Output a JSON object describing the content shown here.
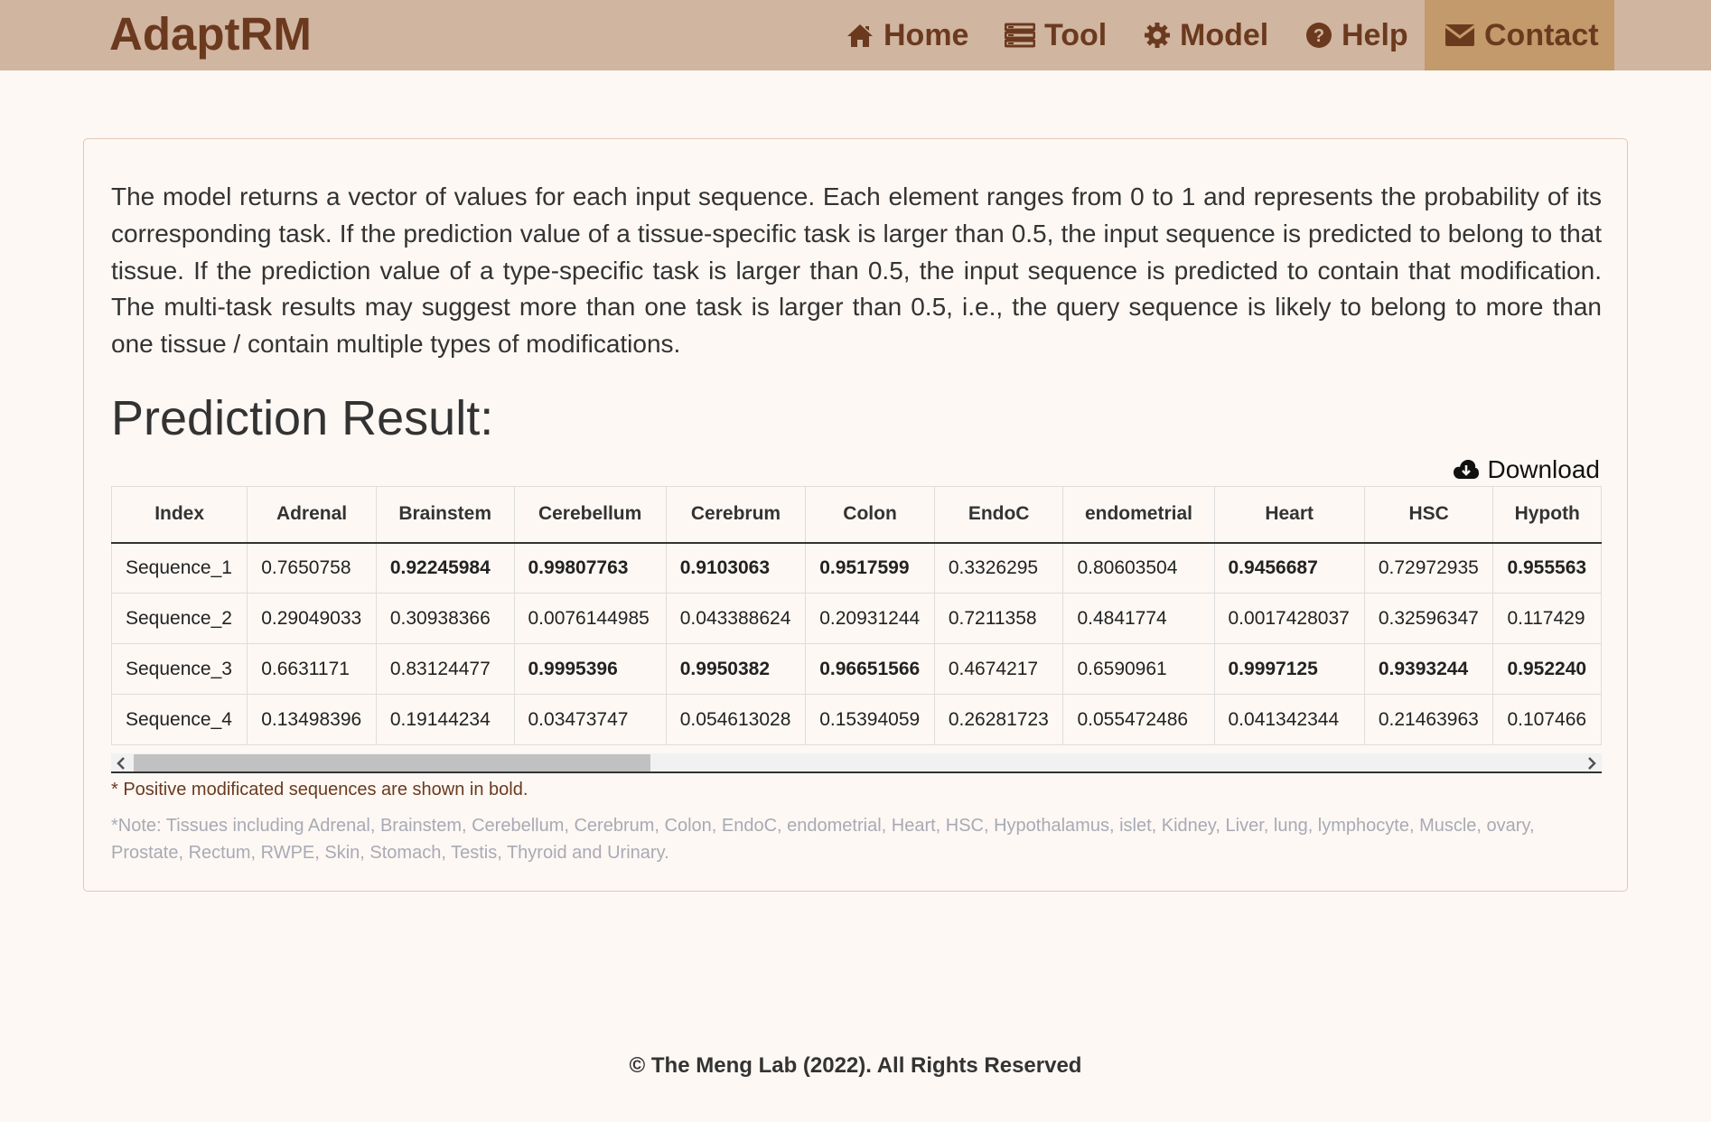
{
  "navbar": {
    "brand": "AdaptRM",
    "items": [
      {
        "label": "Home",
        "icon": "home-icon"
      },
      {
        "label": "Tool",
        "icon": "tool-icon"
      },
      {
        "label": "Model",
        "icon": "gear-icon"
      },
      {
        "label": "Help",
        "icon": "question-icon"
      },
      {
        "label": "Contact",
        "icon": "envelope-icon"
      }
    ],
    "active": "Contact"
  },
  "intro": "The model returns a vector of values for each input sequence. Each element ranges from 0 to 1 and represents the probability of its corresponding task. If the prediction value of a tissue-specific task is larger than 0.5, the input sequence is predicted to belong to that tissue. If the prediction value of a type-specific task is larger than 0.5, the input sequence is predicted to contain that modification. The multi-task results may suggest more than one task is larger than 0.5, i.e., the query sequence is likely to belong to more than one tissue / contain multiple types of modifications.",
  "result_title": "Prediction Result:",
  "download_label": "Download",
  "table": {
    "columns": [
      "Index",
      "Adrenal",
      "Brainstem",
      "Cerebellum",
      "Cerebrum",
      "Colon",
      "EndoC",
      "endometrial",
      "Heart",
      "HSC",
      "Hypoth"
    ],
    "rows": [
      [
        "Sequence_1",
        "0.7650758",
        "0.92245984",
        "0.99807763",
        "0.9103063",
        "0.9517599",
        "0.3326295",
        "0.80603504",
        "0.9456687",
        "0.72972935",
        "0.955563"
      ],
      [
        "Sequence_2",
        "0.29049033",
        "0.30938366",
        "0.0076144985",
        "0.043388624",
        "0.20931244",
        "0.7211358",
        "0.4841774",
        "0.0017428037",
        "0.32596347",
        "0.117429"
      ],
      [
        "Sequence_3",
        "0.6631171",
        "0.83124477",
        "0.9995396",
        "0.9950382",
        "0.96651566",
        "0.4674217",
        "0.6590961",
        "0.9997125",
        "0.9393244",
        "0.952240"
      ],
      [
        "Sequence_4",
        "0.13498396",
        "0.19144234",
        "0.03473747",
        "0.054613028",
        "0.15394059",
        "0.26281723",
        "0.055472486",
        "0.041342344",
        "0.21463963",
        "0.107466"
      ]
    ],
    "bold": [
      [
        false,
        false,
        true,
        true,
        true,
        true,
        false,
        false,
        true,
        false,
        true
      ],
      [
        false,
        false,
        false,
        false,
        false,
        false,
        false,
        false,
        false,
        false,
        false
      ],
      [
        false,
        false,
        false,
        true,
        true,
        true,
        false,
        false,
        true,
        true,
        true
      ],
      [
        false,
        false,
        false,
        false,
        false,
        false,
        false,
        false,
        false,
        false,
        false
      ]
    ]
  },
  "footnote": "* Positive modificated sequences are shown in bold.",
  "note": "*Note: Tissues including Adrenal, Brainstem, Cerebellum, Cerebrum, Colon, EndoC, endometrial, Heart, HSC, Hypothalamus, islet, Kidney, Liver, lung, lymphocyte, Muscle, ovary, Prostate, Rectum, RWPE, Skin, Stomach, Testis, Thyroid and Urinary.",
  "footer": "© The Meng Lab (2022). All Rights Reserved",
  "colors": {
    "navbar_bg": "#d0b5a1",
    "nav_active_bg": "#c39a6b",
    "brand": "#6b3a1e",
    "page_bg": "#fdf8f4",
    "note_text": "#a8aab4"
  }
}
